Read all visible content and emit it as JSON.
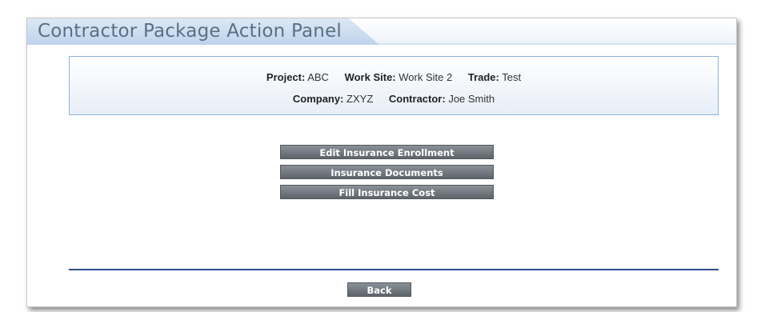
{
  "header": {
    "title": "Contractor Package Action Panel"
  },
  "info": {
    "project_label": "Project:",
    "project_value": "ABC",
    "work_site_label": "Work Site:",
    "work_site_value": "Work Site 2",
    "trade_label": "Trade:",
    "trade_value": "Test",
    "company_label": "Company:",
    "company_value": "ZXYZ",
    "contractor_label": "Contractor:",
    "contractor_value": "Joe Smith"
  },
  "actions": {
    "edit_enrollment": "Edit Insurance Enrollment",
    "insurance_documents": "Insurance Documents",
    "fill_cost": "Fill Insurance Cost"
  },
  "footer": {
    "back": "Back"
  },
  "colors": {
    "title_text": "#5b6f84",
    "tab_fill": "#c9dbf0",
    "info_border": "#8fb1d6",
    "button_fill": "#6e747b",
    "divider": "#2f4d8c"
  }
}
